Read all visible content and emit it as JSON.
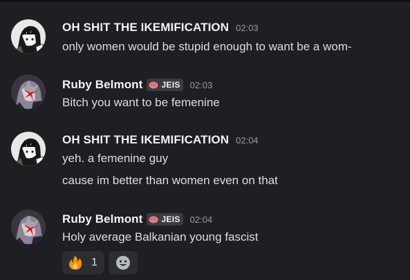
{
  "messages": [
    {
      "username": "OH SHIT THE IKEMIFICATION",
      "timestamp": "02:03",
      "avatar": "anime-avatar-monochrome",
      "lines": [
        "only women would be stupid enough to want be a wom-"
      ]
    },
    {
      "username": "Ruby Belmont",
      "tag": "JEIS",
      "tag_icon": "brain-icon",
      "timestamp": "02:03",
      "avatar": "anime-avatar-red",
      "lines": [
        "Bitch you want to be femenine"
      ]
    },
    {
      "username": "OH SHIT THE IKEMIFICATION",
      "timestamp": "02:04",
      "avatar": "anime-avatar-monochrome",
      "lines": [
        "yeh. a femenine guy",
        "cause im better than women even on that"
      ]
    },
    {
      "username": "Ruby Belmont",
      "tag": "JEIS",
      "tag_icon": "brain-icon",
      "timestamp": "02:04",
      "avatar": "anime-avatar-red",
      "lines": [
        "Holy average Balkanian young fascist"
      ],
      "reactions": [
        {
          "emoji": "fire-icon",
          "count": "1"
        }
      ],
      "add_reaction_icon": "smiley-icon"
    }
  ],
  "colors": {
    "background": "#1e1f22",
    "username": "#f2f3f5",
    "text": "#dbdee1",
    "timestamp": "#949ba4",
    "tag_bg": "#3a3c42",
    "reaction_bg": "#2b2d31"
  }
}
